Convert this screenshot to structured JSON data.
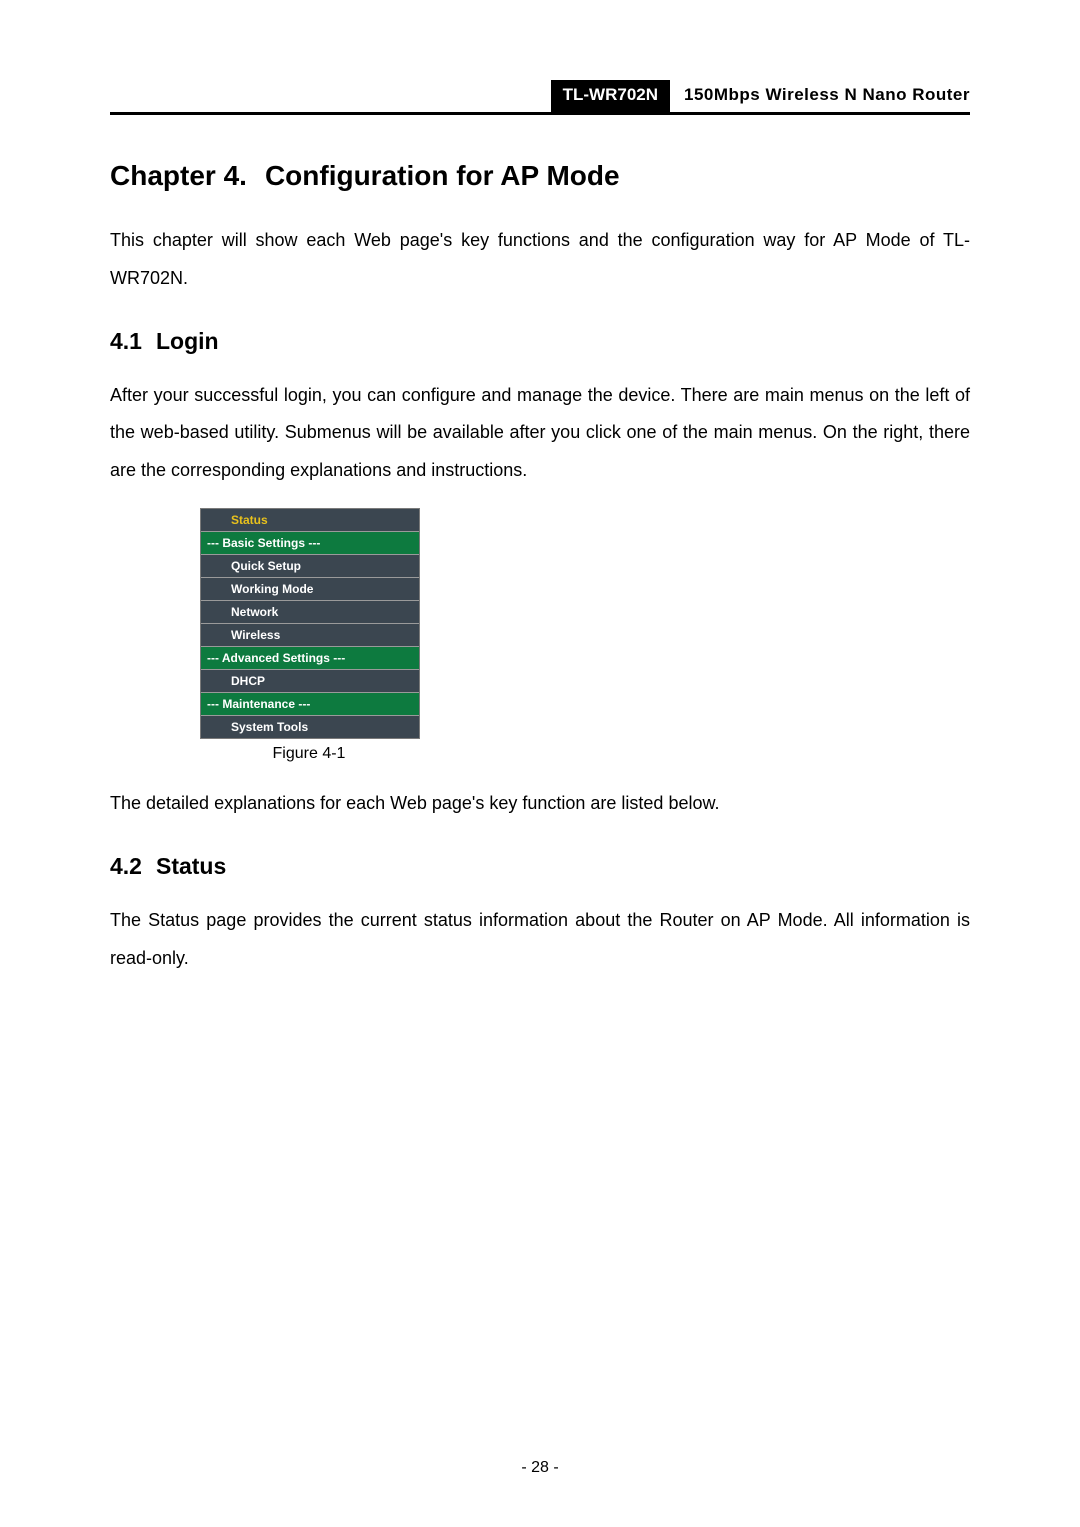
{
  "header": {
    "model": "TL-WR702N",
    "product": "150Mbps Wireless N Nano Router"
  },
  "chapter": {
    "number": "Chapter 4.",
    "title": "Configuration for AP Mode",
    "intro": "This chapter will show each Web page's key functions and the configuration way for AP Mode of TL-WR702N."
  },
  "section_login": {
    "number": "4.1",
    "title": "Login",
    "body": "After your successful login, you can configure and manage the device. There are main menus on the left of the web-based utility. Submenus will be available after you click one of the main menus. On the right, there are the corresponding explanations and instructions."
  },
  "menu": {
    "status": "Status",
    "basic_settings": "--- Basic Settings ---",
    "quick_setup": "Quick Setup",
    "working_mode": "Working Mode",
    "network": "Network",
    "wireless": "Wireless",
    "advanced_settings": "--- Advanced Settings ---",
    "dhcp": "DHCP",
    "maintenance": "--- Maintenance ---",
    "system_tools": "System Tools"
  },
  "figure_caption": "Figure 4-1",
  "after_figure": "The detailed explanations for each Web page's key function are listed below.",
  "section_status": {
    "number": "4.2",
    "title": "Status",
    "body": "The Status page provides the current status information about the Router on AP Mode. All information is read-only."
  },
  "page_number": "- 28 -"
}
